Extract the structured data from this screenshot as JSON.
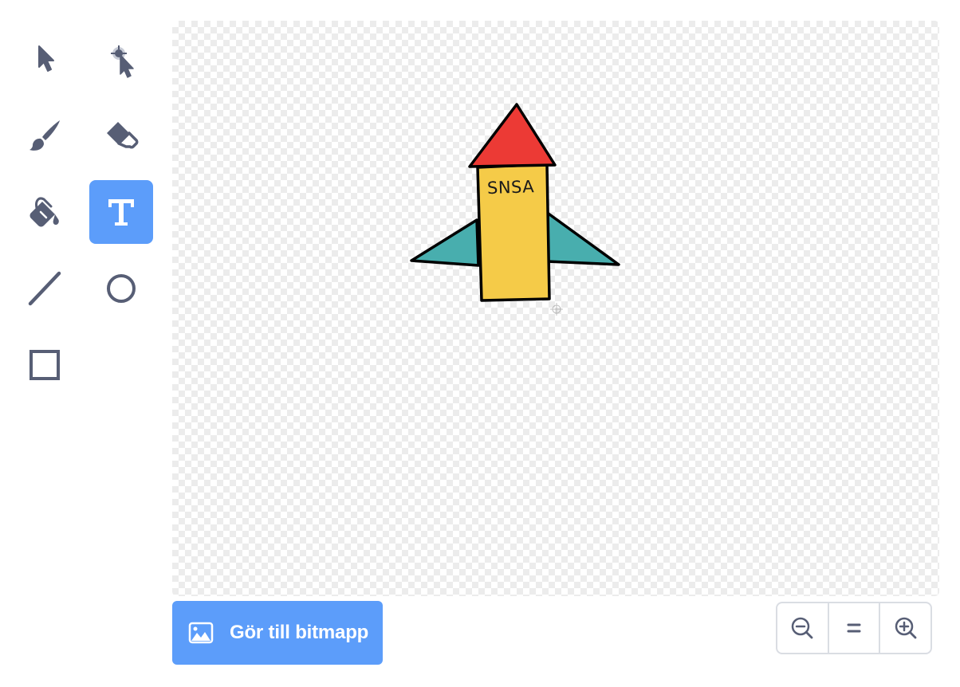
{
  "tools": [
    {
      "name": "select",
      "icon": "arrow-select-icon",
      "active": false
    },
    {
      "name": "reshape",
      "icon": "reshape-icon",
      "active": false
    },
    {
      "name": "brush",
      "icon": "brush-icon",
      "active": false
    },
    {
      "name": "eraser",
      "icon": "eraser-icon",
      "active": false
    },
    {
      "name": "fill",
      "icon": "paint-bucket-icon",
      "active": false
    },
    {
      "name": "text",
      "icon": "text-tool-icon",
      "active": true
    },
    {
      "name": "line",
      "icon": "line-icon",
      "active": false
    },
    {
      "name": "circle",
      "icon": "circle-icon",
      "active": false
    },
    {
      "name": "rectangle",
      "icon": "rectangle-icon",
      "active": false
    }
  ],
  "canvas": {
    "rocket_label": "SNSA"
  },
  "actions": {
    "convert_bitmap_label": "Gör till bitmapp",
    "convert_bitmap_icon": "bitmap-image-icon"
  },
  "zoom": {
    "zoom_out_icon": "zoom-out-icon",
    "reset_icon": "zoom-reset-icon",
    "zoom_in_icon": "zoom-in-icon"
  },
  "colors": {
    "accent": "#5c9dfa",
    "icon": "#575e75",
    "rocket_nose": "#ec3a35",
    "rocket_body": "#f5cb48",
    "rocket_fins": "#48aeae",
    "outline": "#000000"
  }
}
